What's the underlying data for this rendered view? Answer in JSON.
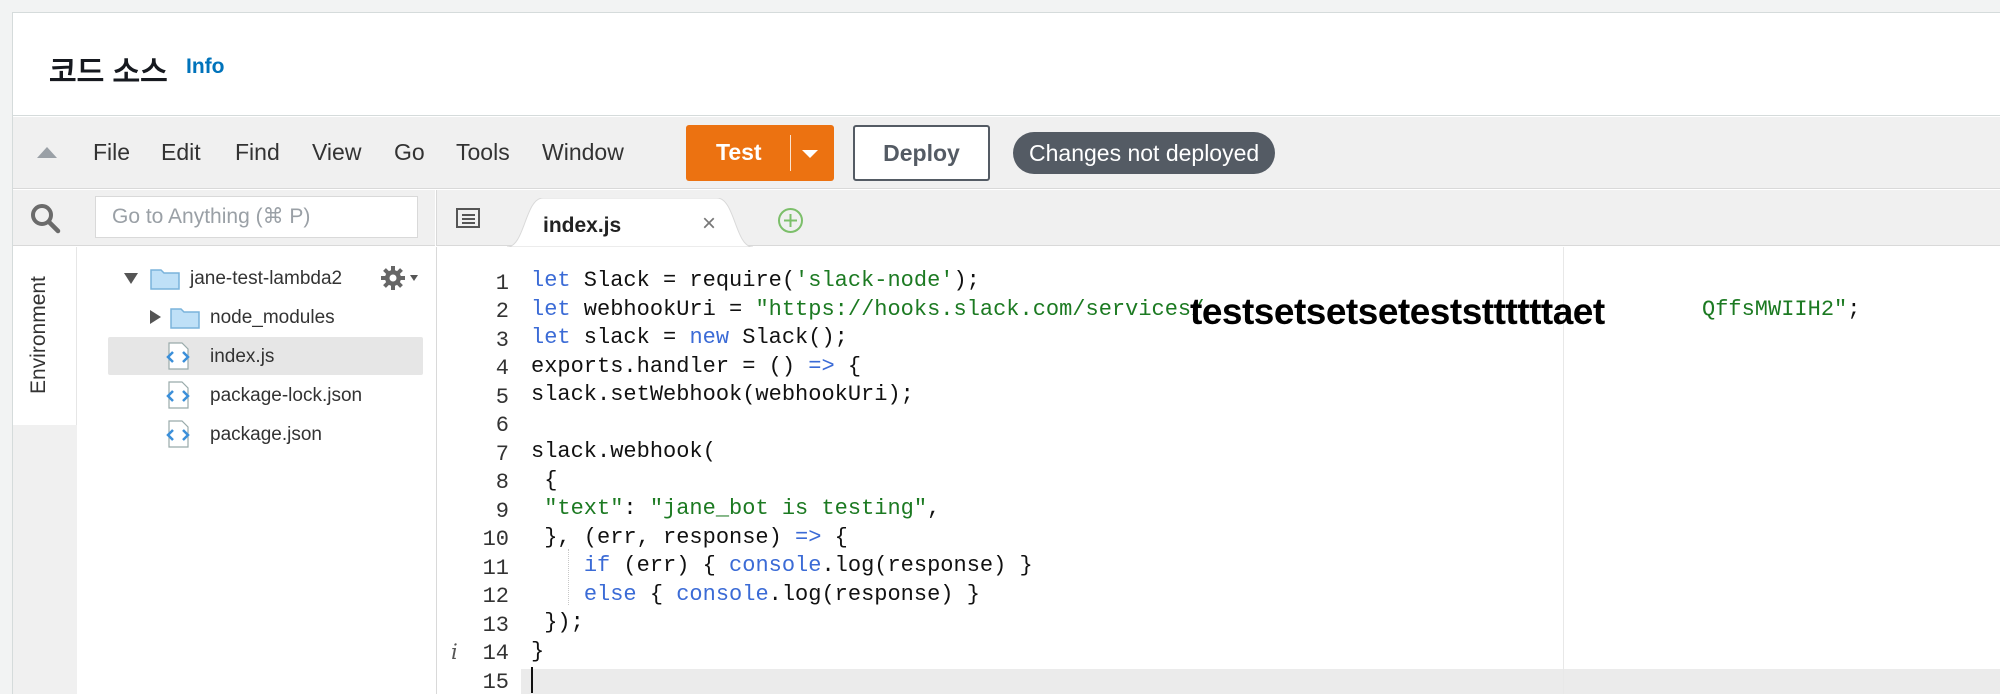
{
  "header": {
    "title": "코드 소스",
    "info_label": "Info"
  },
  "menu": {
    "items": [
      "File",
      "Edit",
      "Find",
      "View",
      "Go",
      "Tools",
      "Window"
    ],
    "test_label": "Test",
    "deploy_label": "Deploy",
    "status_badge": "Changes not deployed"
  },
  "search": {
    "placeholder": "Go to Anything (⌘ P)"
  },
  "environment_tab": "Environment",
  "file_tree": {
    "root": "jane-test-lambda2",
    "items": [
      {
        "name": "node_modules",
        "type": "folder"
      },
      {
        "name": "index.js",
        "type": "file",
        "selected": true
      },
      {
        "name": "package-lock.json",
        "type": "file"
      },
      {
        "name": "package.json",
        "type": "file"
      }
    ]
  },
  "editor": {
    "active_tab": "index.js",
    "line_numbers": [
      "1",
      "2",
      "3",
      "4",
      "5",
      "6",
      "7",
      "8",
      "9",
      "10",
      "11",
      "12",
      "13",
      "14",
      "15"
    ],
    "info_marker": "i",
    "lines": {
      "l1": {
        "a": "let",
        "b": " Slack = require(",
        "c": "'slack-node'",
        "d": ");"
      },
      "l2": {
        "a": "let",
        "b": " webhookUri = ",
        "c": "\"https://hooks.slack.com/services/",
        "d": "QffsMWIIH2\"",
        "e": ";"
      },
      "l3": {
        "a": "let",
        "b": " slack = ",
        "c": "new",
        "d": " Slack();"
      },
      "l4": {
        "a": "exports.handler = () ",
        "b": "=>",
        "c": " {"
      },
      "l5": "slack.setWebhook(webhookUri);",
      "l7": "slack.webhook(",
      "l8": " {",
      "l9": {
        "a": " ",
        "b": "\"text\"",
        "c": ": ",
        "d": "\"jane_bot is testing\"",
        "e": ","
      },
      "l10": {
        "a": " }, (err, response) ",
        "b": "=>",
        "c": " {"
      },
      "l11": {
        "a": "    ",
        "b": "if",
        "c": " (err) { ",
        "d": "console",
        "e": ".log(response) }"
      },
      "l12": {
        "a": "    ",
        "b": "else",
        "c": " { ",
        "d": "console",
        "e": ".log(response) }"
      },
      "l13": " });",
      "l14": "}"
    }
  },
  "overlay_text": "testsetsetseteststtttttaet",
  "colors": {
    "accent_orange": "#ec7211",
    "badge_bg": "#545b64",
    "info_link": "#0073bb",
    "keyword": "#3b6bd6",
    "string": "#1c7a22"
  }
}
